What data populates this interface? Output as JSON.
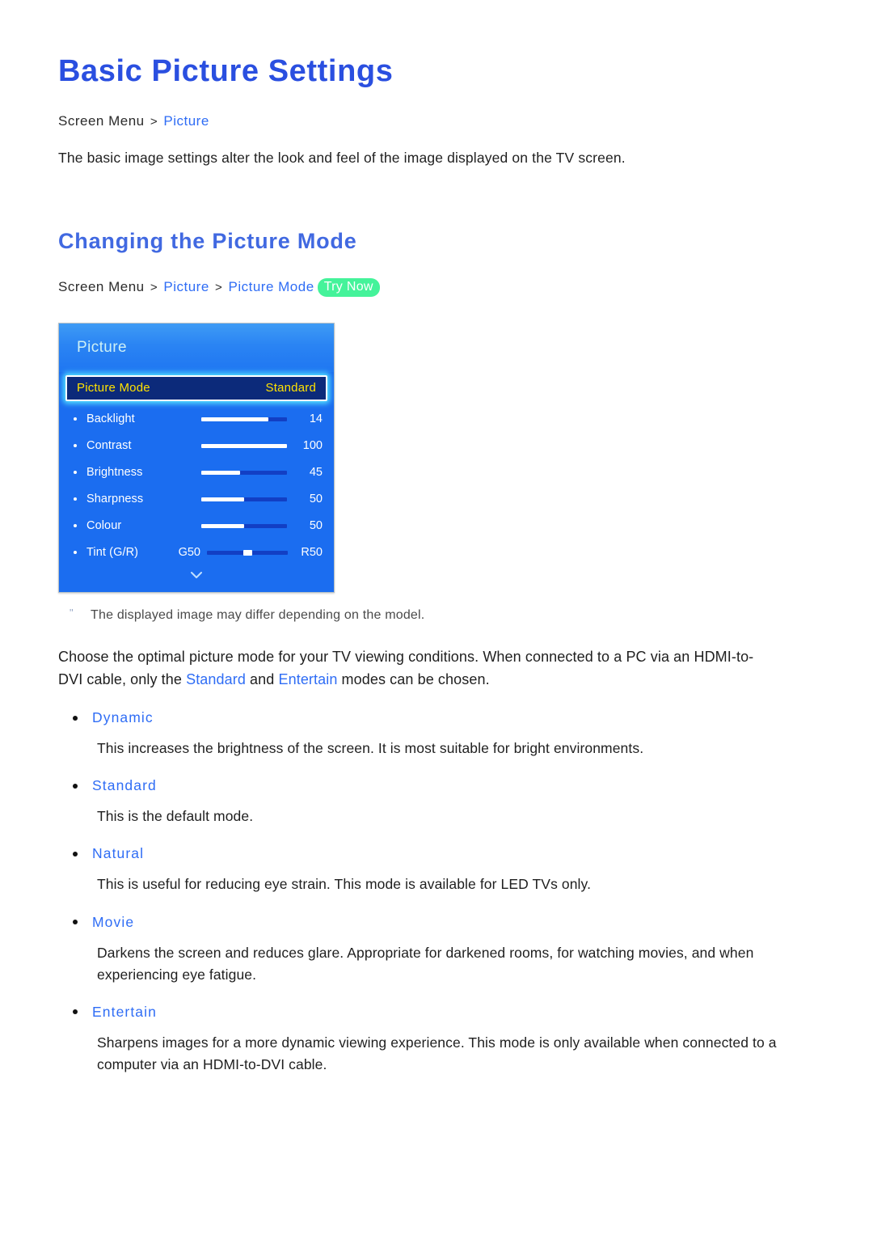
{
  "page": {
    "title": "Basic Picture Settings",
    "section_title": "Changing the Picture Mode"
  },
  "breadcrumb_top": {
    "root": "Screen Menu",
    "sep": ">",
    "leaf": "Picture"
  },
  "intro_text": "The basic image settings alter the look and feel of the image displayed on the TV screen.",
  "breadcrumb_mode": {
    "root": "Screen Menu",
    "sep1": ">",
    "level2": "Picture",
    "sep2": ">",
    "level3": "Picture Mode",
    "badge": "Try Now"
  },
  "osd": {
    "header_title": "Picture",
    "selected_row": {
      "label": "Picture Mode",
      "value": "Standard"
    },
    "items": [
      {
        "name": "Backlight",
        "value": "14",
        "fill_pct": 78
      },
      {
        "name": "Contrast",
        "value": "100",
        "fill_pct": 100
      },
      {
        "name": "Brightness",
        "value": "45",
        "fill_pct": 45
      },
      {
        "name": "Sharpness",
        "value": "50",
        "fill_pct": 50
      },
      {
        "name": "Colour",
        "value": "50",
        "fill_pct": 50
      }
    ],
    "tint_row": {
      "name": "Tint (G/R)",
      "left_label": "G50",
      "right_label": "R50",
      "handle_pct": 45
    },
    "more_icon": "chevron-down-icon"
  },
  "note": {
    "marker": "\"",
    "text": "The displayed image may differ depending on the model."
  },
  "body_paragraph": {
    "part1": "Choose the optimal picture mode for your TV viewing conditions. When connected to a PC via an HDMI-to-DVI cable, only the ",
    "keyword1": "Standard",
    "part2": " and ",
    "keyword2": "Entertain",
    "part3": " modes can be chosen."
  },
  "modes": [
    {
      "title": "Dynamic",
      "description": "This increases the brightness of the screen. It is most suitable for bright environments."
    },
    {
      "title": "Standard",
      "description": "This is the default mode."
    },
    {
      "title": "Natural",
      "description": "This is useful for reducing eye strain. This mode is available for LED TVs only."
    },
    {
      "title": "Movie",
      "description": "Darkens the screen and reduces glare. Appropriate for darkened rooms, for watching movies, and when experiencing eye fatigue."
    },
    {
      "title": "Entertain",
      "description": "Sharpens images for a more dynamic viewing experience. This mode is only available when connected to a computer via an HDMI-to-DVI cable."
    }
  ],
  "colors": {
    "title_blue": "#2a4fe0",
    "heading_blue": "#4169e1",
    "link_blue": "#2f6df5",
    "badge_green": "#44f39a",
    "osd_blue": "#1b6df0",
    "osd_selected_navy": "#0c2a7a",
    "osd_selected_yellow": "#ffe100",
    "osd_glow_cyan": "#55e3ff"
  }
}
